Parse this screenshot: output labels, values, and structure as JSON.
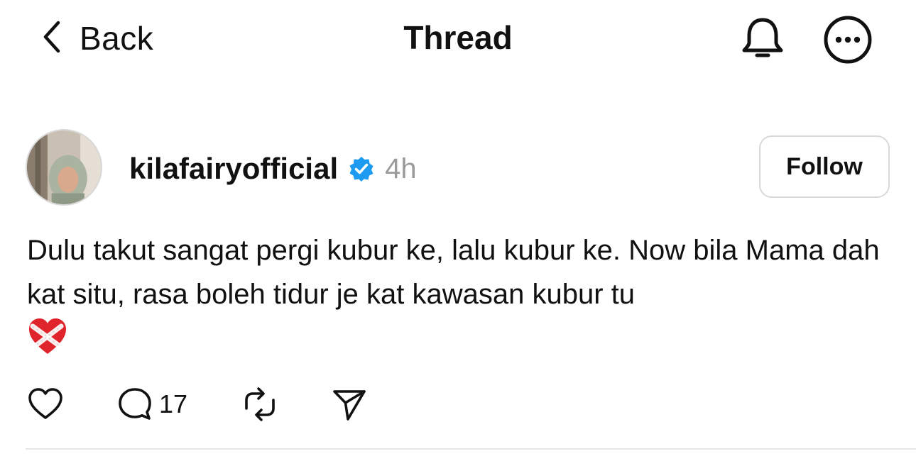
{
  "header": {
    "back_label": "Back",
    "title": "Thread",
    "icons": [
      "chevron-left-icon",
      "bell-icon",
      "more-icon"
    ]
  },
  "post": {
    "username": "kilafairyofficial",
    "verified": true,
    "timestamp": "4h",
    "follow_label": "Follow",
    "text": "Dulu takut sangat pergi kubur ke, lalu kubur ke. Now bila Mama dah kat situ, rasa boleh tidur je kat kawasan kubur tu",
    "emoji": "mending-heart",
    "reply_count": "17",
    "action_icons": [
      "heart-icon",
      "comment-icon",
      "repost-icon",
      "share-icon"
    ]
  },
  "colors": {
    "text": "#111111",
    "muted": "#9a9a9a",
    "verified_blue": "#1d9bf0",
    "border": "#d9d9d9"
  }
}
